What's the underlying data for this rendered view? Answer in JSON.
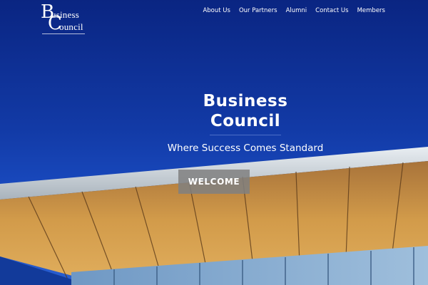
{
  "logo": {
    "letter_b": "B",
    "letter_c": "C",
    "word1": "usiness",
    "word2": "ouncil"
  },
  "nav": {
    "items": [
      {
        "label": "About Us"
      },
      {
        "label": "Our Partners"
      },
      {
        "label": "Alumni"
      },
      {
        "label": "Contact Us"
      },
      {
        "label": "Members"
      }
    ]
  },
  "hero": {
    "title_line1": "Business",
    "title_line2": "Council",
    "tagline": "Where Success Comes Standard",
    "button_label": "WELCOME"
  },
  "colors": {
    "sky_top": "#0a2582",
    "sky_bottom": "#2a5fd0",
    "canopy_wood": "#c9913f",
    "button_bg": "#808080"
  }
}
